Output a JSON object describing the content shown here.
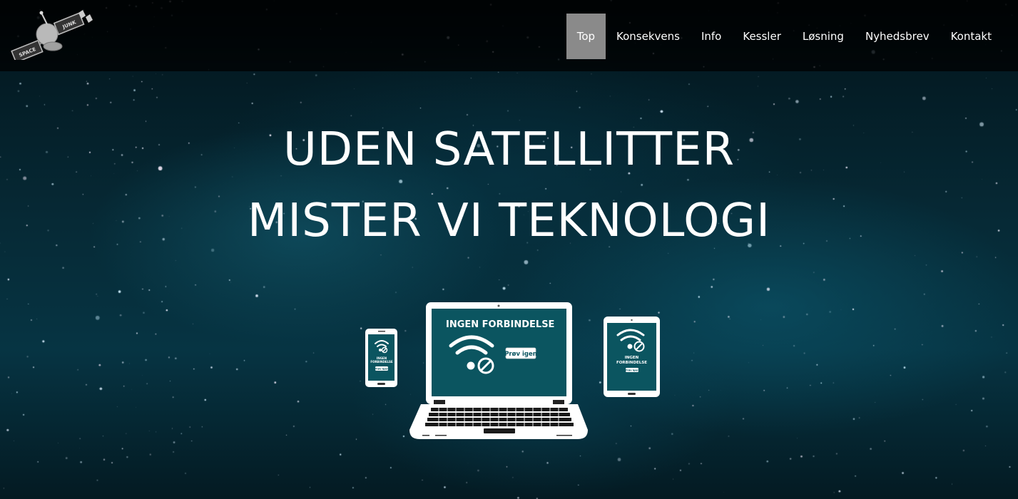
{
  "logo": {
    "text_space": "SPACE",
    "text_junk": "JUNK"
  },
  "nav": {
    "items": [
      {
        "label": "Top",
        "active": true
      },
      {
        "label": "Konsekvens",
        "active": false
      },
      {
        "label": "Info",
        "active": false
      },
      {
        "label": "Kessler",
        "active": false
      },
      {
        "label": "Løsning",
        "active": false
      },
      {
        "label": "Nyhedsbrev",
        "active": false
      },
      {
        "label": "Kontakt",
        "active": false
      }
    ]
  },
  "hero": {
    "headline_line1": "UDEN SATELLITTER",
    "headline_line2": "MISTER VI TEKNOLOGI"
  },
  "devices": {
    "laptop_message": "INGEN FORBINDELSE",
    "laptop_button": "Prøv igen",
    "tablet_message_line1": "INGEN",
    "tablet_message_line2": "FORBINDELSE",
    "tablet_button": "Prøv igen",
    "phone_message_line1": "INGEN",
    "phone_message_line2": "FORBINDELSE",
    "phone_button": "Prøv igen"
  },
  "colors": {
    "active_nav_bg": "#8a8a8a",
    "screen_teal": "#0b5560",
    "text_white": "#ffffff"
  }
}
